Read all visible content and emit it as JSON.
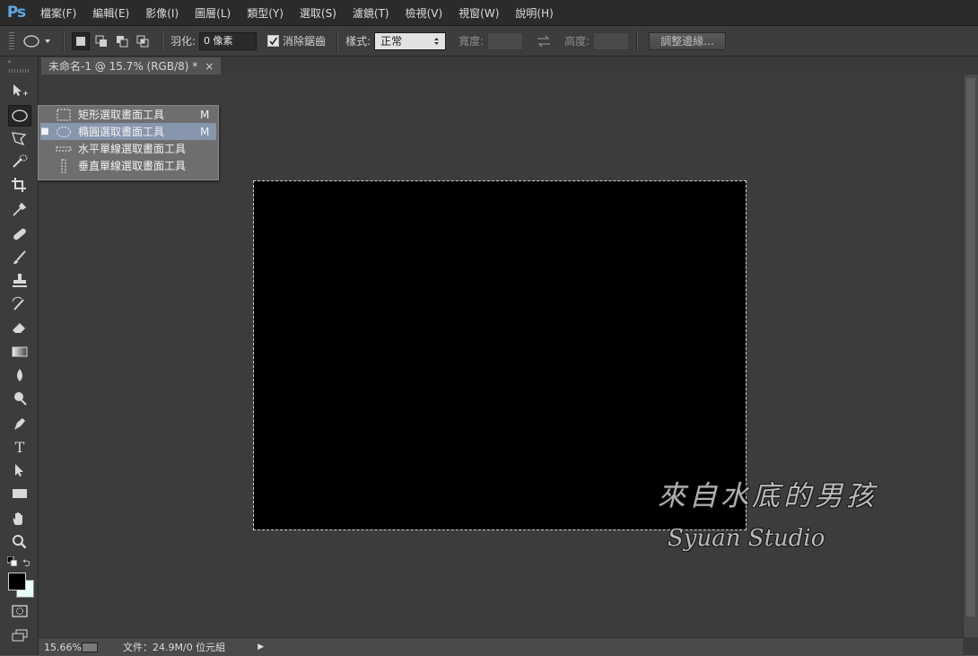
{
  "app": {
    "logo": "Ps"
  },
  "menu": [
    {
      "label": "檔案(F)"
    },
    {
      "label": "編輯(E)"
    },
    {
      "label": "影像(I)"
    },
    {
      "label": "圖層(L)"
    },
    {
      "label": "類型(Y)"
    },
    {
      "label": "選取(S)"
    },
    {
      "label": "濾鏡(T)"
    },
    {
      "label": "檢視(V)"
    },
    {
      "label": "視窗(W)"
    },
    {
      "label": "說明(H)"
    }
  ],
  "options": {
    "feather_label": "羽化:",
    "feather_value": "0 像素",
    "antialias_label": "消除鋸齒",
    "antialias_checked": true,
    "style_label": "樣式:",
    "style_value": "正常",
    "width_label": "寬度:",
    "height_label": "高度:",
    "refine_label": "調整邊緣..."
  },
  "document": {
    "tab_title": "未命名-1 @ 15.7% (RGB/8) *",
    "close": "×",
    "canvas_color": "#000000"
  },
  "flyout": {
    "items": [
      {
        "label": "矩形選取畫面工具",
        "shortcut": "M",
        "selected": false,
        "icon": "rect-marquee-icon"
      },
      {
        "label": "橢圓選取畫面工具",
        "shortcut": "M",
        "selected": true,
        "icon": "ellipse-marquee-icon"
      },
      {
        "label": "水平單線選取畫面工具",
        "shortcut": "",
        "selected": false,
        "icon": "single-row-marquee-icon"
      },
      {
        "label": "垂直單線選取畫面工具",
        "shortcut": "",
        "selected": false,
        "icon": "single-column-marquee-icon"
      }
    ],
    "selected_marker": "■"
  },
  "toolbar": {
    "type_tool_letter": "T"
  },
  "status": {
    "zoom": "15.66%",
    "doc_info": "文件：24.9M/0 位元組",
    "arrow": "▶"
  },
  "watermark": {
    "chinese": "來自水底的男孩",
    "english": "Syuan Studio"
  }
}
